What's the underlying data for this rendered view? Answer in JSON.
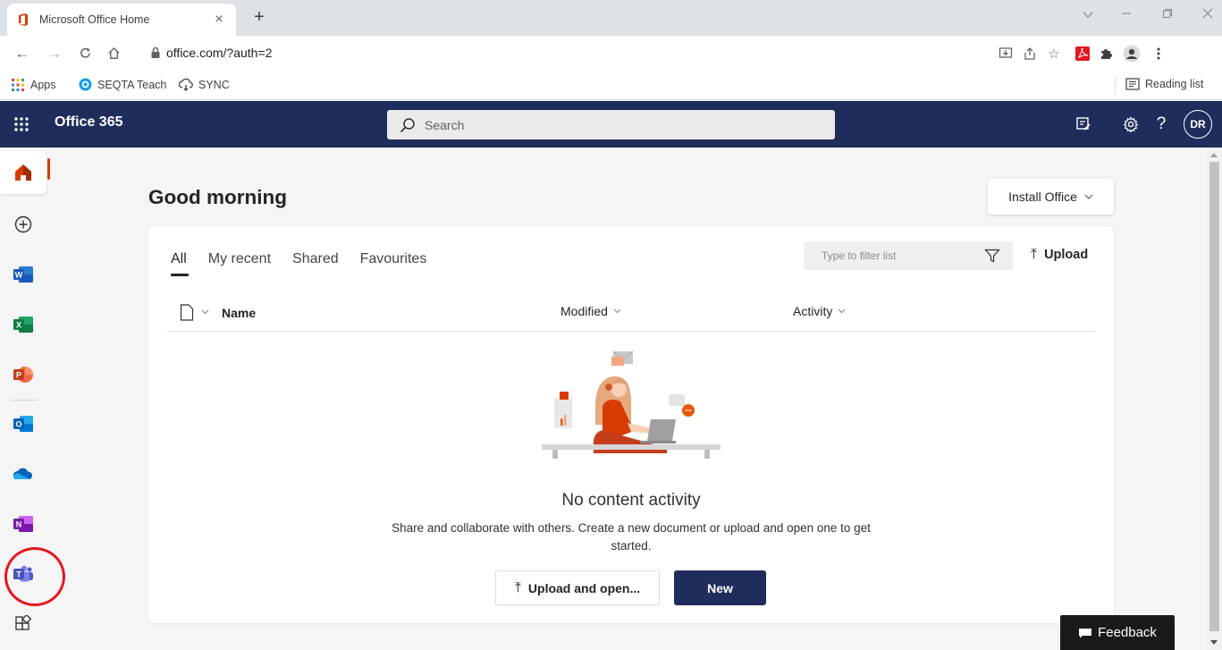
{
  "browser": {
    "tab_title": "Microsoft Office Home",
    "tab_close": "×",
    "new_tab": "+",
    "url": "office.com/?auth=2",
    "bookmarks": [
      {
        "label": "Apps",
        "icon": "apps-grid-icon"
      },
      {
        "label": "SEQTA Teach",
        "icon": "seqta-icon"
      },
      {
        "label": "SYNC",
        "icon": "sync-icon"
      }
    ],
    "reading_list": "Reading list"
  },
  "header": {
    "brand": "Office 365",
    "search_placeholder": "Search",
    "avatar_initials": "DR",
    "help": "?",
    "color": "#1f2d5c"
  },
  "rail": {
    "items": [
      {
        "name": "home",
        "active": true
      },
      {
        "name": "create"
      },
      {
        "name": "word",
        "letter": "W"
      },
      {
        "name": "excel",
        "letter": "X"
      },
      {
        "name": "powerpoint",
        "letter": "P"
      },
      {
        "name": "outlook",
        "letter": "O"
      },
      {
        "name": "onedrive"
      },
      {
        "name": "onenote",
        "letter": "N"
      },
      {
        "name": "teams",
        "letter": "T",
        "highlighted": true
      },
      {
        "name": "all-apps"
      }
    ],
    "accent": "#d83b01",
    "highlight_color": "#e3171e"
  },
  "main": {
    "greeting": "Good morning",
    "install_office": "Install Office",
    "tabs": [
      {
        "label": "All",
        "active": true
      },
      {
        "label": "My recent"
      },
      {
        "label": "Shared"
      },
      {
        "label": "Favourites"
      }
    ],
    "filter_placeholder": "Type to filter list",
    "upload": "Upload",
    "columns": {
      "name": "Name",
      "modified": "Modified",
      "activity": "Activity"
    },
    "empty_title": "No content activity",
    "empty_desc": "Share and collaborate with others. Create a new document or upload and open one to get started.",
    "upload_open": "Upload and open...",
    "new": "New",
    "upload_arrow": "⤒"
  },
  "feedback": "Feedback"
}
